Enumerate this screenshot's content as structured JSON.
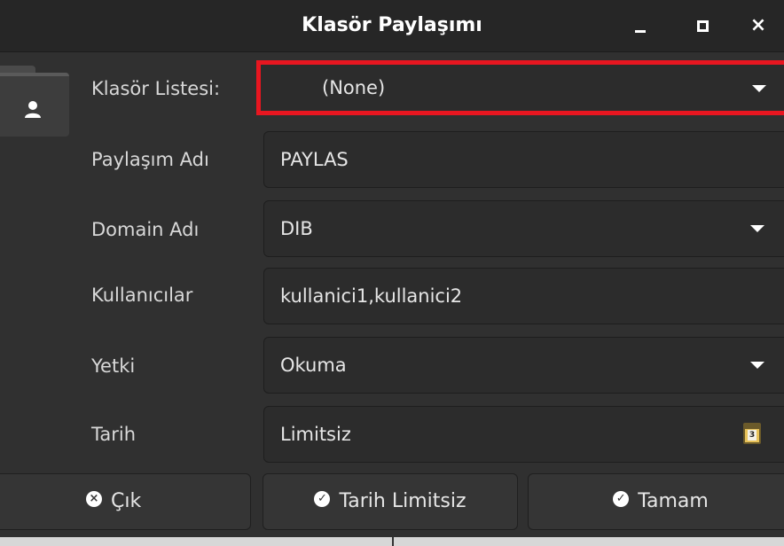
{
  "window": {
    "title": "Klasör Paylaşımı",
    "minimize_glyph": "minimize-icon",
    "maximize_glyph": "maximize-icon",
    "close_glyph": "×"
  },
  "form": {
    "folder_list": {
      "label": "Klasör Listesi:",
      "value": "(None)"
    },
    "share_name": {
      "label": "Paylaşım Adı",
      "value": "PAYLAS"
    },
    "domain_name": {
      "label": "Domain Adı",
      "value": "DIB"
    },
    "users": {
      "label": "Kullanıcılar",
      "value": "kullanici1,kullanici2"
    },
    "permission": {
      "label": "Yetki",
      "value": "Okuma"
    },
    "date": {
      "label": "Tarih",
      "value": "Limitsiz",
      "calendar_number": "3"
    }
  },
  "buttons": {
    "exit": {
      "label": "Çık",
      "icon": "x-circle-icon",
      "icon_glyph": "×"
    },
    "date_unlimited": {
      "label": "Tarih Limitsiz",
      "icon": "check-circle-icon",
      "icon_glyph": "✓"
    },
    "ok": {
      "label": "Tamam",
      "icon": "check-circle-icon",
      "icon_glyph": "✓"
    }
  },
  "colors": {
    "highlight_border": "#e81620",
    "background": "#303030",
    "titlebar": "#262626",
    "text": "#e6e6e6"
  }
}
